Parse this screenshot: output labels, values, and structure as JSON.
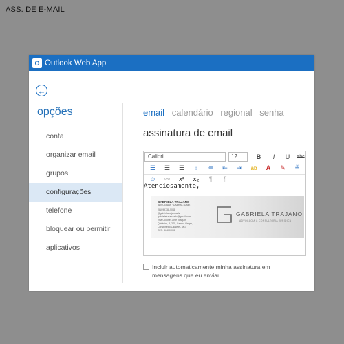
{
  "page_label": "ASS. DE E-MAIL",
  "app": {
    "title": "Outlook Web App",
    "logo_letter": "O",
    "brand_color": "#1b6fc2"
  },
  "back_icon": "arrow-left-circle-icon",
  "sidebar": {
    "title": "opções",
    "items": [
      {
        "label": "conta"
      },
      {
        "label": "organizar email"
      },
      {
        "label": "grupos"
      },
      {
        "label": "configurações",
        "active": true
      },
      {
        "label": "telefone"
      },
      {
        "label": "bloquear ou permitir"
      },
      {
        "label": "aplicativos"
      }
    ]
  },
  "tabs": [
    {
      "label": "email",
      "active": true
    },
    {
      "label": "calendário"
    },
    {
      "label": "regional"
    },
    {
      "label": "senha"
    }
  ],
  "heading": "assinatura de email",
  "editor": {
    "font": "Calibri",
    "size": "12",
    "bold": "B",
    "italic": "I",
    "underline": "U",
    "strike": "abc",
    "superscript": "x²",
    "subscript": "x₂",
    "body_text": "Atenciosamente,"
  },
  "signature": {
    "name": "GABRIELA TRAJANO",
    "subtitle": "ADVOGADA · CABRAL (OAB)",
    "lines": [
      "(51) 99738-5048",
      "@gabrielatrajanoadv",
      "gabrielatrajanoadv@gmail.com",
      "Rua Coronel José Joaquim",
      "Quinteiro, 8, 270, Campo Alegre,",
      "Conselheiro Lafaiete - MG,",
      "CEP: 36400-098"
    ],
    "brand": "GABRIELA TRAJANO",
    "brand_sub": "ADVOCACIA & CONSULTORIA JURÍDICA"
  },
  "auto_include": {
    "label": "Incluir automaticamente minha assinatura em mensagens que eu enviar",
    "checked": false
  }
}
